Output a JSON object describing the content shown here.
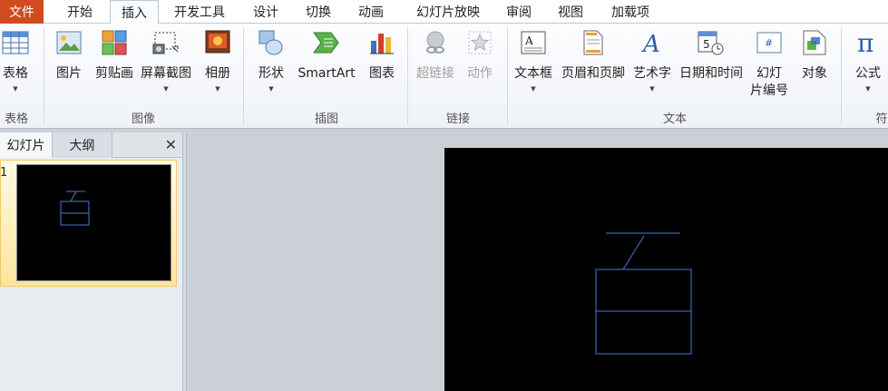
{
  "tabs": {
    "file": "文件",
    "home": "开始",
    "insert": "插入",
    "developer": "开发工具",
    "design": "设计",
    "transitions": "切换",
    "animations": "动画",
    "slideshow": "幻灯片放映",
    "review": "审阅",
    "view": "视图",
    "addins": "加载项"
  },
  "ribbon": {
    "table": "表格",
    "picture": "图片",
    "clipart": "剪贴画",
    "screenshot": "屏幕截图",
    "album": "相册",
    "shapes": "形状",
    "smartart": "SmartArt",
    "chart": "图表",
    "hyperlink": "超链接",
    "action": "动作",
    "textbox": "文本框",
    "headerfooter": "页眉和页脚",
    "wordart": "艺术字",
    "datetime": "日期和时间",
    "slidenum_line1": "幻灯",
    "slidenum_line2": "片编号",
    "object": "对象",
    "equation": "公式"
  },
  "groups": {
    "tables": "表格",
    "images": "图像",
    "illustrations": "插图",
    "links": "链接",
    "text": "文本",
    "symbols": "符"
  },
  "pane": {
    "tab_slides": "幻灯片",
    "tab_outline": "大纲",
    "close": "✕",
    "slide_number": "1"
  },
  "colors": {
    "file_tab": "#d04b1d",
    "shape_stroke": "#4a78d8",
    "slide_bg": "#000000"
  }
}
